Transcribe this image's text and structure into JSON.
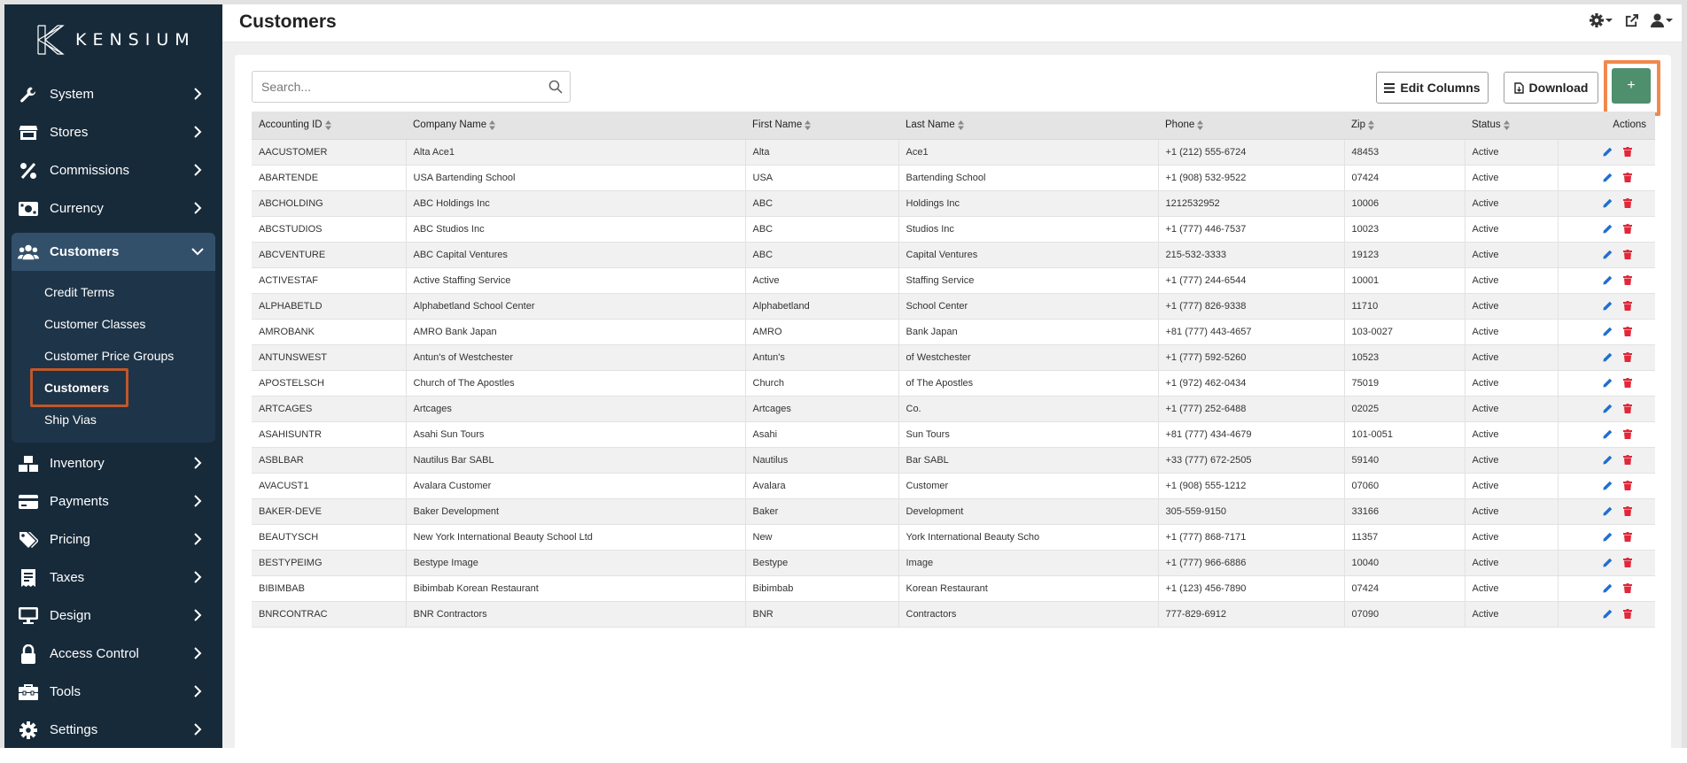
{
  "app": {
    "logo_text": "KENSIUM"
  },
  "header": {
    "title": "Customers"
  },
  "sidebar": {
    "items": [
      {
        "label": "System",
        "icon": "wrench-icon"
      },
      {
        "label": "Stores",
        "icon": "store-icon"
      },
      {
        "label": "Commissions",
        "icon": "percent-icon"
      },
      {
        "label": "Currency",
        "icon": "money-bill-icon"
      },
      {
        "label": "Customers",
        "icon": "users-icon"
      },
      {
        "label": "Inventory",
        "icon": "boxes-icon"
      },
      {
        "label": "Payments",
        "icon": "credit-card-icon"
      },
      {
        "label": "Pricing",
        "icon": "tags-icon"
      },
      {
        "label": "Taxes",
        "icon": "receipt-icon"
      },
      {
        "label": "Design",
        "icon": "monitor-icon"
      },
      {
        "label": "Access Control",
        "icon": "lock-icon"
      },
      {
        "label": "Tools",
        "icon": "toolbox-icon"
      },
      {
        "label": "Settings",
        "icon": "gear-icon"
      }
    ],
    "customers_submenu": [
      "Credit Terms",
      "Customer Classes",
      "Customer Price Groups",
      "Customers",
      "Ship Vias"
    ]
  },
  "toolbar": {
    "search_placeholder": "Search...",
    "edit_columns_label": "Edit Columns",
    "download_label": "Download",
    "add_label": "+"
  },
  "table": {
    "columns": [
      "Accounting ID",
      "Company Name",
      "First Name",
      "Last Name",
      "Phone",
      "Zip",
      "Status",
      "Actions"
    ],
    "rows": [
      [
        "AACUSTOMER",
        "Alta Ace1",
        "Alta",
        "Ace1",
        "+1 (212) 555-6724",
        "48453",
        "Active"
      ],
      [
        "ABARTENDE",
        "USA Bartending School",
        "USA",
        "Bartending School",
        "+1 (908) 532-9522",
        "07424",
        "Active"
      ],
      [
        "ABCHOLDING",
        "ABC Holdings Inc",
        "ABC",
        "Holdings Inc",
        "1212532952",
        "10006",
        "Active"
      ],
      [
        "ABCSTUDIOS",
        "ABC Studios Inc",
        "ABC",
        "Studios Inc",
        "+1 (777) 446-7537",
        "10023",
        "Active"
      ],
      [
        "ABCVENTURE",
        "ABC Capital Ventures",
        "ABC",
        "Capital Ventures",
        "215-532-3333",
        "19123",
        "Active"
      ],
      [
        "ACTIVESTAF",
        "Active Staffing Service",
        "Active",
        "Staffing Service",
        "+1 (777) 244-6544",
        "10001",
        "Active"
      ],
      [
        "ALPHABETLD",
        "Alphabetland School Center",
        "Alphabetland",
        "School Center",
        "+1 (777) 826-9338",
        "11710",
        "Active"
      ],
      [
        "AMROBANK",
        "AMRO Bank Japan",
        "AMRO",
        "Bank Japan",
        "+81 (777) 443-4657",
        "103-0027",
        "Active"
      ],
      [
        "ANTUNSWEST",
        "Antun's of Westchester",
        "Antun's",
        "of Westchester",
        "+1 (777) 592-5260",
        "10523",
        "Active"
      ],
      [
        "APOSTELSCH",
        "Church of The Apostles",
        "Church",
        "of The Apostles",
        "+1 (972) 462-0434",
        "75019",
        "Active"
      ],
      [
        "ARTCAGES",
        "Artcages",
        "Artcages",
        "Co.",
        "+1 (777) 252-6488",
        "02025",
        "Active"
      ],
      [
        "ASAHISUNTR",
        "Asahi Sun Tours",
        "Asahi",
        "Sun Tours",
        "+81 (777) 434-4679",
        "101-0051",
        "Active"
      ],
      [
        "ASBLBAR",
        "Nautilus Bar SABL",
        "Nautilus",
        "Bar SABL",
        "+33 (777) 672-2505",
        "59140",
        "Active"
      ],
      [
        "AVACUST1",
        "Avalara Customer",
        "Avalara",
        "Customer",
        "+1 (908) 555-1212",
        "07060",
        "Active"
      ],
      [
        "BAKER-DEVE",
        "Baker Development",
        "Baker",
        "Development",
        "305-559-9150",
        "33166",
        "Active"
      ],
      [
        "BEAUTYSCH",
        "New York International Beauty School Ltd",
        "New",
        "York International Beauty Scho",
        "+1 (777) 868-7171",
        "11357",
        "Active"
      ],
      [
        "BESTYPEIMG",
        "Bestype Image",
        "Bestype",
        "Image",
        "+1 (777) 966-6886",
        "10040",
        "Active"
      ],
      [
        "BIBIMBAB",
        "Bibimbab Korean Restaurant",
        "Bibimbab",
        "Korean Restaurant",
        "+1 (123) 456-7890",
        "07424",
        "Active"
      ],
      [
        "BNRCONTRAC",
        "BNR Contractors",
        "BNR",
        "Contractors",
        "777-829-6912",
        "07090",
        "Active"
      ]
    ]
  },
  "colors": {
    "sidebar_bg": "#172a3a",
    "sidebar_active": "#33506b",
    "add_button": "#4e8f6e",
    "edit_icon": "#1f6fd1",
    "delete_icon": "#e0283a",
    "highlight_orange": "#f0894e"
  }
}
